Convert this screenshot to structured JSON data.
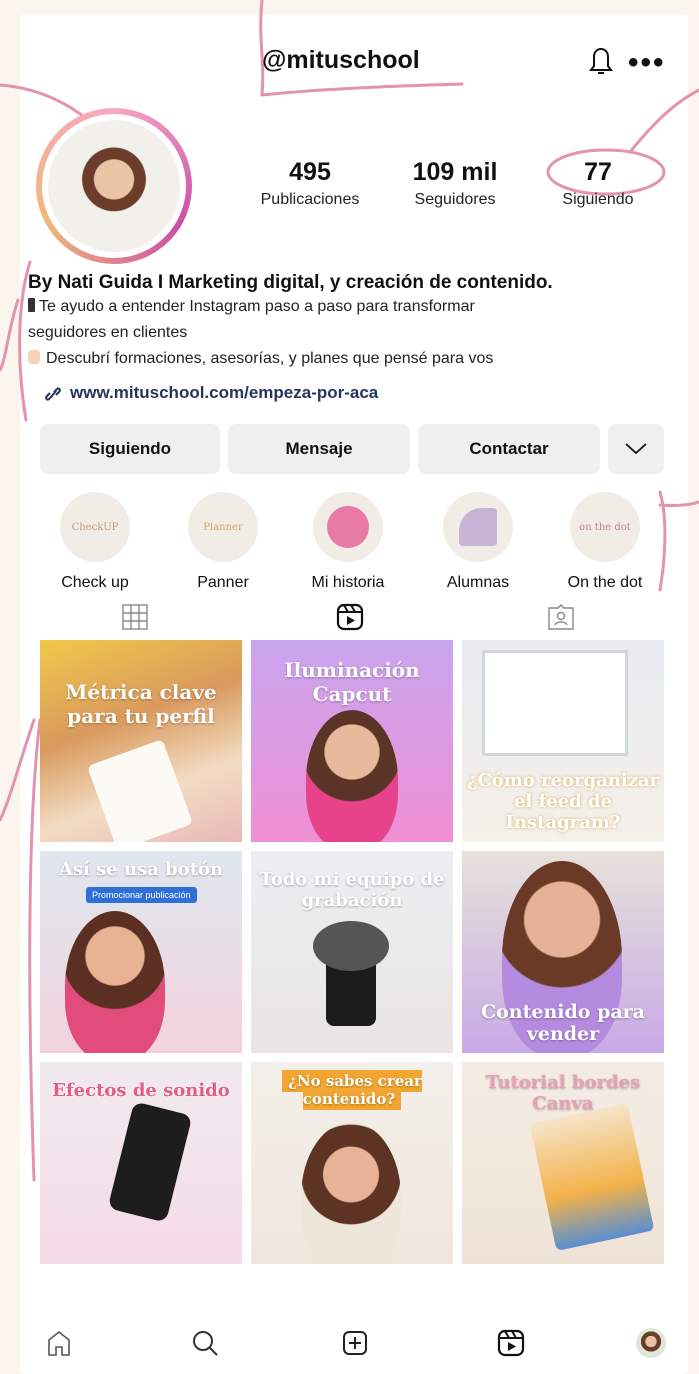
{
  "profile": {
    "username": "@mituschool",
    "stats": [
      {
        "value": "495",
        "label": "Publicaciones"
      },
      {
        "value": "109 mil",
        "label": "Seguidores"
      },
      {
        "value": "77",
        "label": "Siguiendo"
      }
    ],
    "bio_name": "By Nati Guida I Marketing digital, y creación de contenido.",
    "bio_lines": [
      "Te ayudo a entender Instagram paso a paso para transformar",
      "seguidores en clientes",
      "Descubrí formaciones, asesorías, y planes que pensé para vos"
    ],
    "link": "www.mituschool.com/empeza-por-aca"
  },
  "buttons": {
    "following": "Siguiendo",
    "message": "Mensaje",
    "contact": "Contactar"
  },
  "highlights": [
    {
      "label": "Check up",
      "cover_text": "CheckUP"
    },
    {
      "label": "Panner",
      "cover_text": "Planner"
    },
    {
      "label": "Mi historia",
      "cover_text": ""
    },
    {
      "label": "Alumnas",
      "cover_text": ""
    },
    {
      "label": "On the dot",
      "cover_text": "on the dot"
    }
  ],
  "tabs": [
    "grid-icon",
    "reels-icon",
    "tagged-icon"
  ],
  "posts": [
    {
      "caption": "Métrica clave para tu perfil"
    },
    {
      "caption": "Iluminación Capcut"
    },
    {
      "caption": "¿Cómo reorganizar el feed de Instagram?"
    },
    {
      "caption": "Así se usa botón",
      "badge": "Promocionar publicación"
    },
    {
      "caption": "Todo mi equipo de grabación"
    },
    {
      "caption": "Contenido para vender"
    },
    {
      "caption": "Efectos de sonido"
    },
    {
      "caption": "¿No sabes crear contenido?"
    },
    {
      "caption": "Tutorial bordes Canva"
    }
  ],
  "nav": [
    "home-icon",
    "search-icon",
    "create-icon",
    "reels-icon",
    "profile-avatar"
  ],
  "colors": {
    "accent_pink": "#e493ad",
    "link_blue": "#24355e",
    "button_bg": "#efefef"
  }
}
